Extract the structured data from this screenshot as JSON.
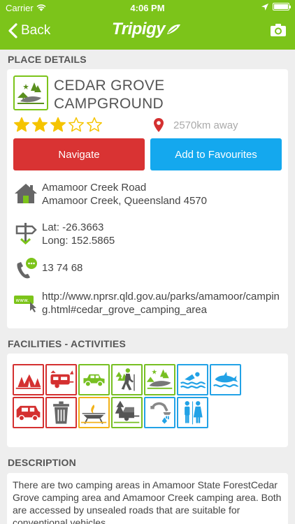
{
  "status_bar": {
    "carrier": "Carrier",
    "time": "4:06 PM"
  },
  "nav": {
    "back_label": "Back",
    "logo_text": "Tripigy"
  },
  "place_details": {
    "section_title": "PLACE DETAILS",
    "name": "CEDAR GROVE CAMPGROUND",
    "rating": 3,
    "rating_max": 5,
    "distance": "2570km away",
    "navigate_label": "Navigate",
    "favourite_label": "Add to Favourites",
    "address_line1": "Amamoor Creek Road",
    "address_line2": "Amamoor Creek, Queensland 4570",
    "lat": "Lat: -26.3663",
    "long": "Long: 152.5865",
    "phone": "13 74 68",
    "website": "http://www.nprsr.qld.gov.au/parks/amamoor/camping.html#cedar_grove_camping_area"
  },
  "facilities": {
    "section_title": "FACILITIES - ACTIVITIES",
    "items": [
      {
        "icon": "tent-camping-icon",
        "color": "#d43030"
      },
      {
        "icon": "caravan-icon",
        "color": "#d43030"
      },
      {
        "icon": "4wd-vehicle-icon",
        "color": "#77bf22"
      },
      {
        "icon": "bushwalking-icon",
        "color": "#77bf22"
      },
      {
        "icon": "lake-scenery-icon",
        "color": "#77bf22"
      },
      {
        "icon": "swimming-icon",
        "color": "#22a2e6"
      },
      {
        "icon": "dolphin-wildlife-icon",
        "color": "#22a2e6"
      },
      {
        "icon": "campervan-icon",
        "color": "#d43030"
      },
      {
        "icon": "rubbish-bin-icon",
        "color": "#d43030"
      },
      {
        "icon": "fire-barbecue-icon",
        "color": "#f2b21a"
      },
      {
        "icon": "camper-trailer-icon",
        "color": "#77bf22"
      },
      {
        "icon": "shower-tap-icon",
        "color": "#22a2e6"
      },
      {
        "icon": "toilets-icon",
        "color": "#22a2e6"
      }
    ]
  },
  "description": {
    "section_title": "DESCRIPTION",
    "text": "There are two camping areas in Amamoor State ForestCedar Grove camping area and Amamoor Creek camping area. Both are accessed by unsealed roads that are suitable for conventional vehicles."
  },
  "colors": {
    "brand_green": "#7cc41a",
    "navigate_red": "#d93333",
    "favourite_blue": "#14a8ee",
    "star_yellow": "#f5c400"
  }
}
